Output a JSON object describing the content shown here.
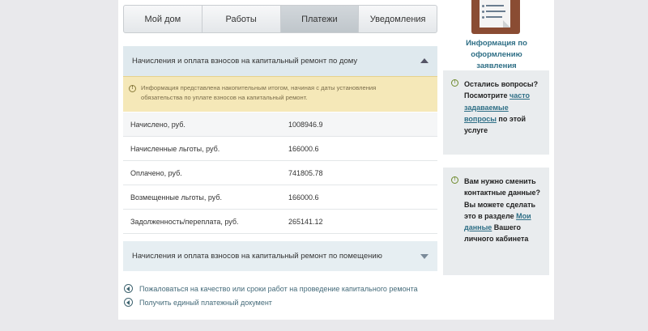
{
  "tabs": [
    {
      "label": "Мой дом"
    },
    {
      "label": "Работы"
    },
    {
      "label": "Платежи",
      "active": true
    },
    {
      "label": "Уведомления"
    }
  ],
  "section1": {
    "title": "Начисления и оплата взносов на капитальный ремонт по дому",
    "info_line1": "Информация представлена накопительным итогом, начиная с даты установления",
    "info_line2": "обязательства по уплате взносов на капитальный ремонт."
  },
  "rows": [
    {
      "label": "Начислено, руб.",
      "value": "1008946.9"
    },
    {
      "label": "Начисленные льготы, руб.",
      "value": "166000.6"
    },
    {
      "label": "Оплачено, руб.",
      "value": "741805.78"
    },
    {
      "label": "Возмещенные льготы, руб.",
      "value": "166000.6"
    },
    {
      "label": "Задолженность/переплата, руб.",
      "value": "265141.12"
    }
  ],
  "section2": {
    "title": "Начисления и оплата взносов на капитальный ремонт по помещению"
  },
  "links": {
    "complain": "Пожаловаться на качество или сроки работ на проведение капитального ремонта",
    "get_document": "Получить единый платежный документ"
  },
  "sidebar": {
    "info_link_line1": "Информация по",
    "info_link_line2": "оформлению заявления",
    "faq": {
      "pre": "Остались вопросы? Посмотрите ",
      "link": "часто задаваемые вопросы",
      "post": " по этой услуге"
    },
    "contacts": {
      "pre": "Вам нужно сменить контактные данные? Вы можете сделать это в разделе ",
      "link": "Мои данные",
      "post": " Вашего личного кабинета"
    }
  },
  "colors": {
    "accent_link": "#2f6f86",
    "info_bg": "#f5e8b8",
    "section_bg": "#dfe9ee"
  }
}
